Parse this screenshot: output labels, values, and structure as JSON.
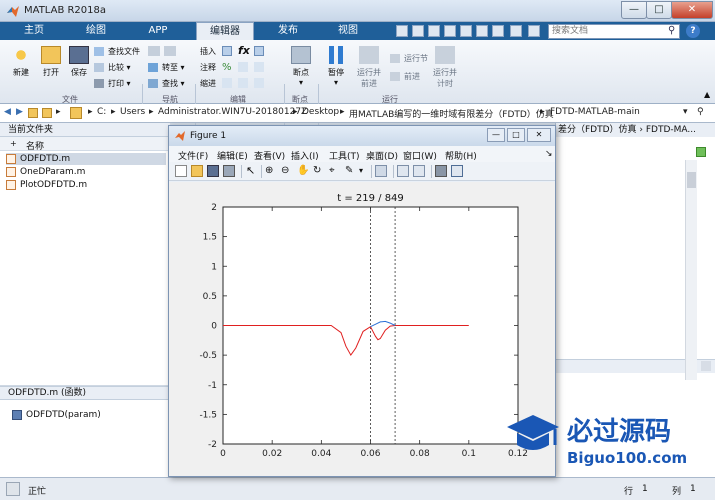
{
  "window": {
    "title": "MATLAB R2018a",
    "min": "—",
    "max": "□",
    "close": "✕"
  },
  "tabs": [
    {
      "label": "主页"
    },
    {
      "label": "绘图"
    },
    {
      "label": "APP"
    },
    {
      "label": "编辑器"
    },
    {
      "label": "发布"
    },
    {
      "label": "视图"
    }
  ],
  "search": {
    "placeholder": "搜索文档"
  },
  "ribbon": {
    "file": {
      "new": "新建",
      "open": "打开",
      "save": "保存",
      "find_files": "查找文件",
      "compare": "比较",
      "print": "打印",
      "group": "文件"
    },
    "navigate": {
      "goto": "转至",
      "find": "查找",
      "group": "导航"
    },
    "edit": {
      "insert": "插入",
      "comment": "注释",
      "indent": "缩进",
      "fx": "fx",
      "group": "编辑"
    },
    "breakpoints": {
      "label": "断点",
      "group": "断点"
    },
    "run": {
      "pause": "暂停",
      "run_advance": "运行并\n前进",
      "run_section": "运行节",
      "advance": "前进",
      "run_time": "运行并\n计时",
      "group": "运行"
    }
  },
  "address": {
    "crumbs": [
      "C:",
      "Users",
      "Administrator.WIN7U-20180127Z",
      "Desktop",
      "用MATLAB编写的一维时域有限差分（FDTD）仿真",
      "FDTD-MATLAB-main"
    ]
  },
  "folder": {
    "header": "当前文件夹",
    "col_name": "名称",
    "files": [
      "ODFDTD.m",
      "OneDParam.m",
      "PlotODFDTD.m"
    ]
  },
  "details": {
    "header": "ODFDTD.m  (函数)",
    "item": "ODFDTD(param)"
  },
  "cmd": {
    "header": "差分（FDTD）仿真 › FDTD-MA..."
  },
  "status": {
    "left": "正忙",
    "row": "行",
    "row_val": "1",
    "col": "列",
    "col_val": "1"
  },
  "figure": {
    "title": "Figure 1",
    "menus": [
      "文件(F)",
      "编辑(E)",
      "查看(V)",
      "插入(I)",
      "工具(T)",
      "桌面(D)",
      "窗口(W)",
      "帮助(H)"
    ]
  },
  "chart_data": {
    "type": "line",
    "title": "t = 219 / 849",
    "xlim": [
      0,
      0.12
    ],
    "ylim": [
      -2,
      2
    ],
    "xticks": [
      0,
      0.02,
      0.04,
      0.06,
      0.08,
      0.1,
      0.12
    ],
    "yticks": [
      -2,
      -1.5,
      -1,
      -0.5,
      0,
      0.5,
      1,
      1.5,
      2
    ],
    "vlines": [
      0.06,
      0.07
    ],
    "series": [
      {
        "color": "#e02020",
        "x": [
          0,
          0.044,
          0.048,
          0.05,
          0.052,
          0.054,
          0.057,
          0.06,
          0.062,
          0.063,
          0.064,
          0.066,
          0.068,
          0.07,
          0.1
        ],
        "y": [
          0,
          0,
          -0.12,
          -0.35,
          -0.5,
          -0.38,
          -0.1,
          -0.02,
          -0.18,
          -0.24,
          -0.22,
          -0.08,
          -0.01,
          0,
          0
        ]
      },
      {
        "color": "#2a6fd6",
        "x": [
          0.06,
          0.062,
          0.064,
          0.066,
          0.068,
          0.07
        ],
        "y": [
          -0.02,
          0.02,
          0.06,
          0.07,
          0.04,
          0
        ]
      }
    ]
  },
  "colors": {
    "accent": "#1f5f99",
    "red_series": "#e02020",
    "blue_series": "#2a6fd6"
  },
  "watermark": {
    "logo_text": "必过源码",
    "url": "Biguo100.com"
  }
}
